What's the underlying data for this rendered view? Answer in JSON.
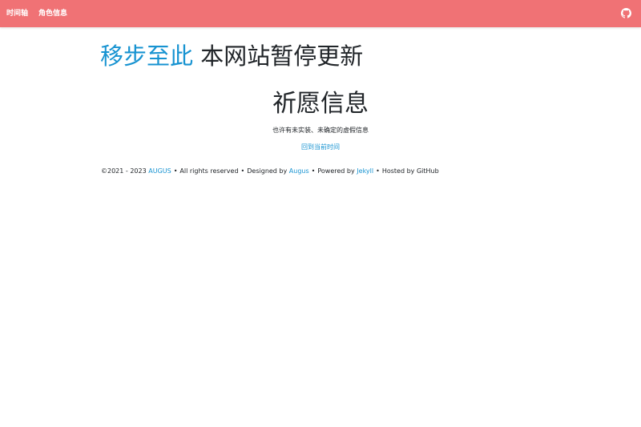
{
  "navbar": {
    "items": [
      {
        "label": "时间轴"
      },
      {
        "label": "角色信息"
      }
    ],
    "github_icon": "github-icon",
    "background_color": "#f07275"
  },
  "notice": {
    "link_text": "移步至此",
    "text": " 本网站暂停更新"
  },
  "main": {
    "title": "祈愿信息",
    "subtitle": "也许有未实装、未确定的虚假信息",
    "back_link": "回到当前时间"
  },
  "footer": {
    "copyright": "©2021 - 2023 ",
    "owner_link": "AUGUS",
    "bullet": "•",
    "rights": "All rights reserved",
    "designed_by": "Designed by ",
    "designer_link": "Augus",
    "powered_by": "Powered by ",
    "engine_link": "Jekyll",
    "hosted_by": "Hosted by GitHub"
  },
  "colors": {
    "accent": "#1793d1",
    "text": "#212529"
  }
}
